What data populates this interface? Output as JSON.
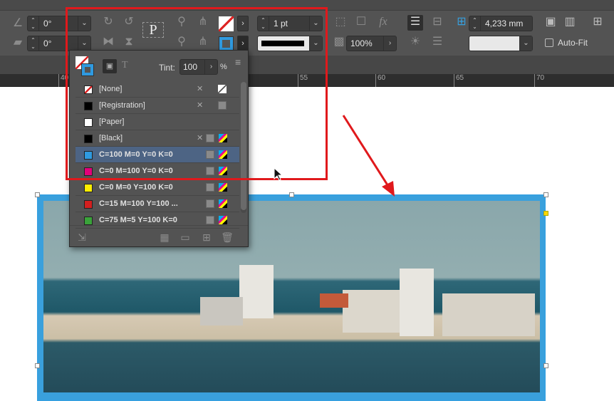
{
  "toolbar": {
    "rotate_angle": "0°",
    "shear_angle": "0°",
    "stroke_weight": "1 pt",
    "opacity": "100%",
    "offset": "4,233 mm",
    "autofit_label": "Auto-Fit",
    "proxy_letter": "P"
  },
  "ruler": {
    "ticks": [
      "40",
      "55",
      "60",
      "65",
      "70"
    ]
  },
  "swatches_panel": {
    "tint_label": "Tint:",
    "tint_value": "100",
    "percent": "%",
    "text_mode": "T",
    "swatches": [
      {
        "name": "[None]",
        "color": "none"
      },
      {
        "name": "[Registration]",
        "color": "#000000"
      },
      {
        "name": "[Paper]",
        "color": "#ffffff"
      },
      {
        "name": "[Black]",
        "color": "#000000"
      },
      {
        "name": "C=100 M=0 Y=0 K=0",
        "color": "#2f9ae0",
        "selected": true
      },
      {
        "name": "C=0 M=100 Y=0 K=0",
        "color": "#e2007a"
      },
      {
        "name": "C=0 M=0 Y=100 K=0",
        "color": "#ffee00"
      },
      {
        "name": "C=15 M=100 Y=100 ...",
        "color": "#d41f1f"
      },
      {
        "name": "C=75 M=5 Y=100 K=0",
        "color": "#3aa33a"
      }
    ]
  },
  "colors": {
    "accent": "#36a0e0",
    "annotation": "#e0191c"
  }
}
